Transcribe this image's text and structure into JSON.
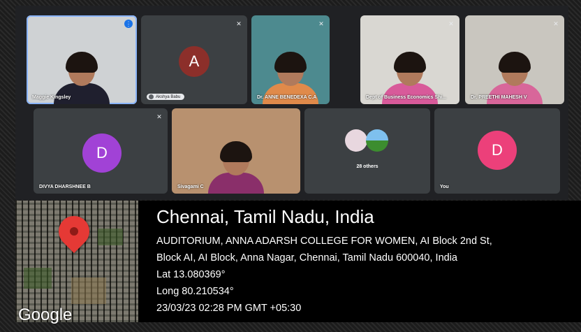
{
  "participants": [
    {
      "name": "Maggie Kingsley",
      "speaking": true
    },
    {
      "name": "Akshya Babu",
      "initial": "A",
      "color": "#8c2f2a"
    },
    {
      "name": "Dr. ANNE BENEDEXA C.A"
    },
    {
      "name": "Dept of Business Economics Shi..."
    },
    {
      "name": "Dr. PREETHI MAHESH V"
    },
    {
      "name": "DIVYA DHARSHNEE B",
      "initial": "D",
      "color": "#a142d6"
    },
    {
      "name": "Sivagami C"
    },
    {
      "name": "28 others"
    },
    {
      "name": "You",
      "initial": "D",
      "color": "#ec407a"
    }
  ],
  "icons": {
    "mic_off": "mic-off-icon",
    "speaking": "audio-wave-icon"
  },
  "location": {
    "city": "Chennai, Tamil Nadu, India",
    "address_line1": "AUDITORIUM, ANNA ADARSH COLLEGE FOR WOMEN, AI Block 2nd St,",
    "address_line2": "Block AI, AI Block, Anna Nagar, Chennai, Tamil Nadu 600040, India",
    "lat": "Lat 13.080369°",
    "long": "Long 80.210534°",
    "timestamp": "23/03/23 02:28 PM GMT +05:30",
    "map_brand": "Google"
  }
}
